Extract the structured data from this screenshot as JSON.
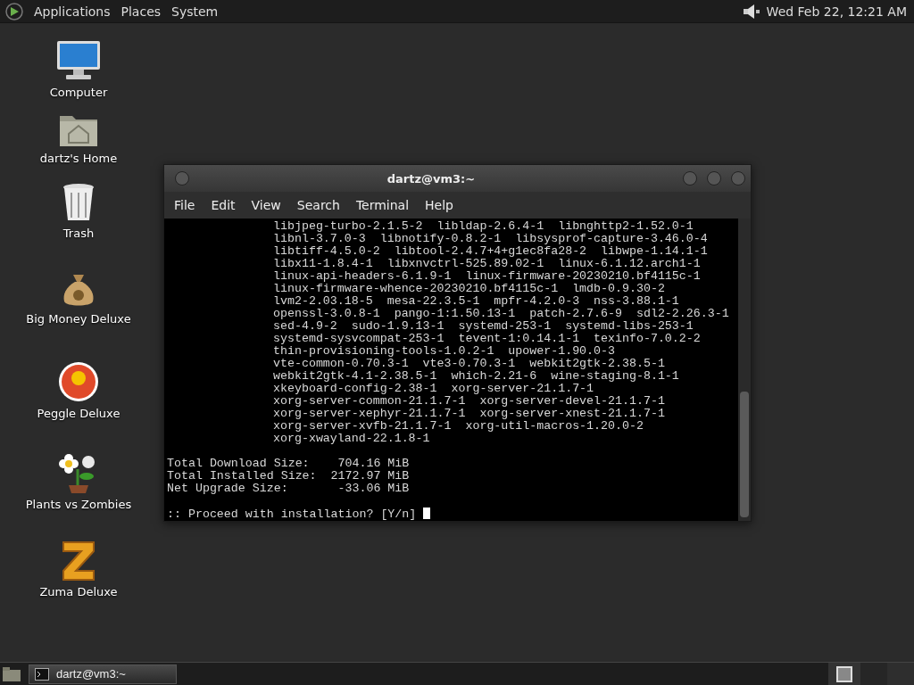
{
  "top_panel": {
    "menus": [
      "Applications",
      "Places",
      "System"
    ],
    "clock": "Wed Feb 22, 12:21 AM"
  },
  "desktop_icons": [
    {
      "label": "Computer",
      "kind": "computer"
    },
    {
      "label": "dartz's Home",
      "kind": "home"
    },
    {
      "label": "Trash",
      "kind": "trash"
    },
    {
      "label": "Big Money Deluxe",
      "kind": "money"
    },
    {
      "label": "Peggle Deluxe",
      "kind": "peggle"
    },
    {
      "label": "Plants vs Zombies",
      "kind": "plants"
    },
    {
      "label": "Zuma Deluxe",
      "kind": "zuma"
    }
  ],
  "terminal_window": {
    "title": "dartz@vm3:~",
    "menu": [
      "File",
      "Edit",
      "View",
      "Search",
      "Terminal",
      "Help"
    ],
    "package_lines": [
      "libjpeg-turbo-2.1.5-2  libldap-2.6.4-1  libnghttp2-1.52.0-1",
      "libnl-3.7.0-3  libnotify-0.8.2-1  libsysprof-capture-3.46.0-4",
      "libtiff-4.5.0-2  libtool-2.4.7+4+g1ec8fa28-2  libwpe-1.14.1-1",
      "libx11-1.8.4-1  libxnvctrl-525.89.02-1  linux-6.1.12.arch1-1",
      "linux-api-headers-6.1.9-1  linux-firmware-20230210.bf4115c-1",
      "linux-firmware-whence-20230210.bf4115c-1  lmdb-0.9.30-2",
      "lvm2-2.03.18-5  mesa-22.3.5-1  mpfr-4.2.0-3  nss-3.88.1-1",
      "openssl-3.0.8-1  pango-1:1.50.13-1  patch-2.7.6-9  sdl2-2.26.3-1",
      "sed-4.9-2  sudo-1.9.13-1  systemd-253-1  systemd-libs-253-1",
      "systemd-sysvcompat-253-1  tevent-1:0.14.1-1  texinfo-7.0.2-2",
      "thin-provisioning-tools-1.0.2-1  upower-1.90.0-3",
      "vte-common-0.70.3-1  vte3-0.70.3-1  webkit2gtk-2.38.5-1",
      "webkit2gtk-4.1-2.38.5-1  which-2.21-6  wine-staging-8.1-1",
      "xkeyboard-config-2.38-1  xorg-server-21.1.7-1",
      "xorg-server-common-21.1.7-1  xorg-server-devel-21.1.7-1",
      "xorg-server-xephyr-21.1.7-1  xorg-server-xnest-21.1.7-1",
      "xorg-server-xvfb-21.1.7-1  xorg-util-macros-1.20.0-2",
      "xorg-xwayland-22.1.8-1"
    ],
    "summary_lines": [
      "Total Download Size:    704.16 MiB",
      "Total Installed Size:  2172.97 MiB",
      "Net Upgrade Size:       -33.06 MiB"
    ],
    "prompt": ":: Proceed with installation? [Y/n]"
  },
  "taskbar": {
    "tasks": [
      {
        "label": "dartz@vm3:~"
      }
    ]
  }
}
